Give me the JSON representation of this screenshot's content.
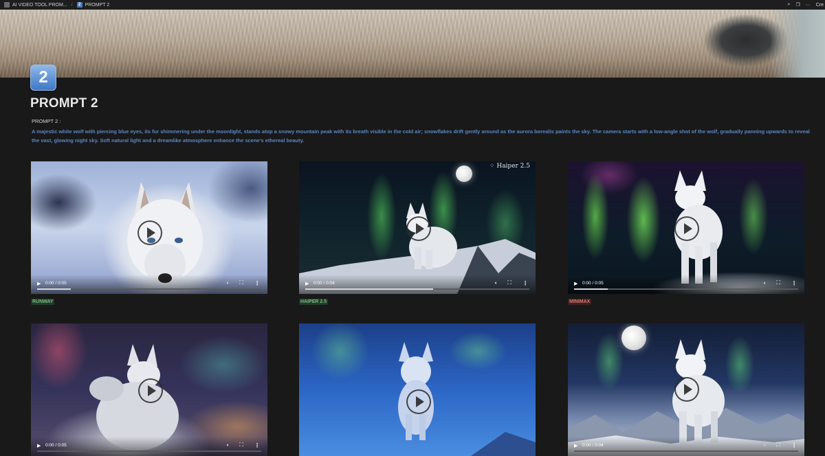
{
  "topbar": {
    "breadcrumb_1": "AI VIDEO TOOL PROM...",
    "breadcrumb_2": "PROMPT 2",
    "action_extra": "Cre"
  },
  "page": {
    "icon_glyph": "2",
    "title": "PROMPT 2",
    "prompt_label": "PROMPT 2 :",
    "prompt_text": "A majestic white wolf with piercing blue eyes, its fur shimmering under the moonlight, stands atop a snowy mountain peak with its breath visible in the cold air; snowflakes drift gently around as the aurora borealis paints the sky. The camera starts with a low-angle shot of the wolf, gradually panning upwards to reveal the vast, glowing night sky. Soft natural light and a dreamlike atmosphere enhance the scene's ethereal beauty."
  },
  "videos": [
    {
      "time": "0:00 / 0:05",
      "progress": 0.15,
      "caption": "RUNWAY"
    },
    {
      "time": "0:00 / 0:04",
      "progress": 0.57,
      "caption": "HAIPER 2.5",
      "watermark": "⁘ Haiper 2.5"
    },
    {
      "time": "0:00 / 0:05",
      "progress": 0.15,
      "caption": "MINIMAX"
    },
    {
      "time": "0:00 / 0:05",
      "progress": 0.0
    },
    {
      "time": "",
      "progress": 0.0
    },
    {
      "time": "0:00 / 0:04",
      "progress": 0.0
    }
  ],
  "colors": {
    "background": "#191919",
    "prompt_text": "#5a86c5",
    "caption_green": "#6fbf82",
    "caption_red": "#e0736d"
  }
}
